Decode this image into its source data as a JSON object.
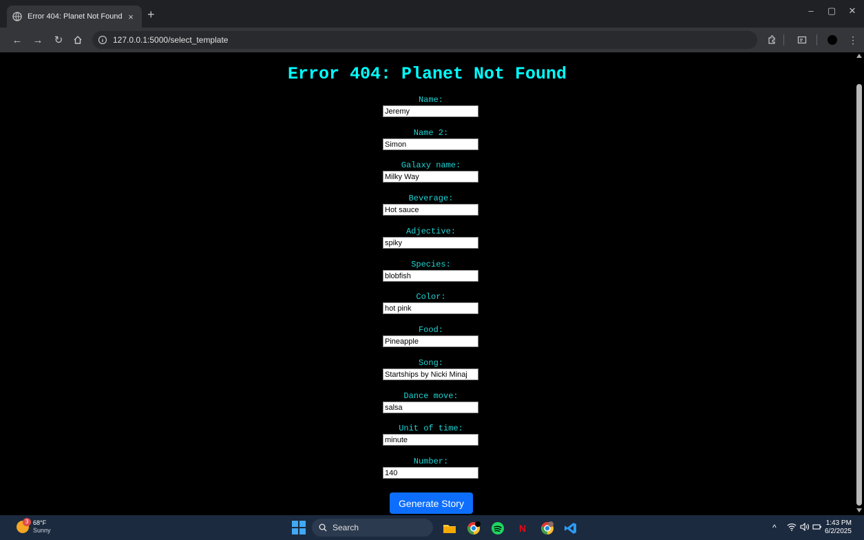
{
  "browser": {
    "tab_title": "Error 404: Planet Not Found",
    "tab_close": "×",
    "new_tab": "+",
    "url": "127.0.0.1:5000/select_template",
    "window_controls": {
      "minimize": "–",
      "restore": "▢",
      "close": "✕"
    }
  },
  "page": {
    "title": "Error 404: Planet Not Found",
    "fields": [
      {
        "label": "Name:",
        "value": "Jeremy"
      },
      {
        "label": "Name 2:",
        "value": "Simon"
      },
      {
        "label": "Galaxy name:",
        "value": "Milky Way"
      },
      {
        "label": "Beverage:",
        "value": "Hot sauce"
      },
      {
        "label": "Adjective:",
        "value": "spiky"
      },
      {
        "label": "Species:",
        "value": "blobfish"
      },
      {
        "label": "Color:",
        "value": "hot pink"
      },
      {
        "label": "Food:",
        "value": "Pineapple"
      },
      {
        "label": "Song:",
        "value": "Startships by Nicki Minaj"
      },
      {
        "label": "Dance move:",
        "value": "salsa"
      },
      {
        "label": "Unit of time:",
        "value": "minute"
      },
      {
        "label": "Number:",
        "value": "140"
      }
    ],
    "submit_label": "Generate Story"
  },
  "taskbar": {
    "weather_temp": "68°F",
    "weather_condition": "Sunny",
    "weather_badge": "3",
    "search_label": "Search",
    "time": "1:43 PM",
    "date": "6/2/2025"
  },
  "colors": {
    "title": "#00ffff",
    "label": "#1fd5d5",
    "button": "#0d6efd",
    "background": "#000000"
  }
}
